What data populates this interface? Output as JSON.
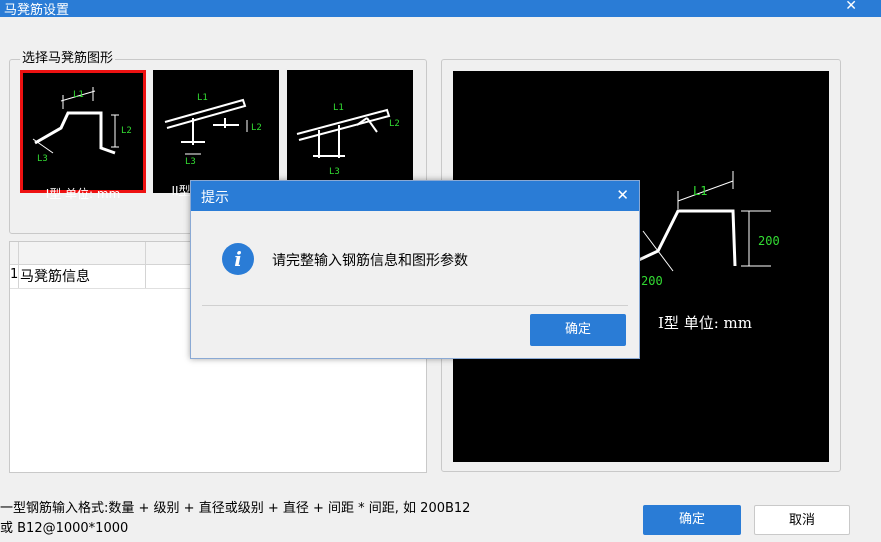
{
  "window": {
    "title": "马凳筋设置",
    "close": "✕"
  },
  "shape_group": {
    "label": "选择马凳筋图形",
    "thumbs": [
      {
        "caption": "I型 单位: mm",
        "labels": [
          "L1",
          "L2",
          "L3"
        ],
        "selected": true
      },
      {
        "caption": "II型",
        "labels": [
          "L1",
          "L2",
          "L3"
        ],
        "selected": false
      },
      {
        "caption": "",
        "labels": [
          "L1",
          "L2",
          "L3"
        ],
        "selected": false
      }
    ]
  },
  "table": {
    "rows": [
      {
        "num": "1",
        "name": "马凳筋信息",
        "value": ""
      }
    ]
  },
  "preview": {
    "labels": {
      "l1": "L1",
      "h": "200",
      "l3": "200"
    },
    "caption": "I型 单位: mm"
  },
  "hint": {
    "line1": "一型钢筋输入格式:数量 + 级别 + 直径或级别 + 直径 + 间距 * 间距, 如 200B12",
    "line2": "或 B12@1000*1000"
  },
  "buttons": {
    "ok": "确定",
    "cancel": "取消"
  },
  "dialog": {
    "title": "提示",
    "close": "✕",
    "message": "请完整输入钢筋信息和图形参数",
    "ok": "确定",
    "icon": "info-icon"
  },
  "colors": {
    "accent": "#2a7cd6",
    "selected_border": "#e11111",
    "dim_label": "#33dd33"
  }
}
